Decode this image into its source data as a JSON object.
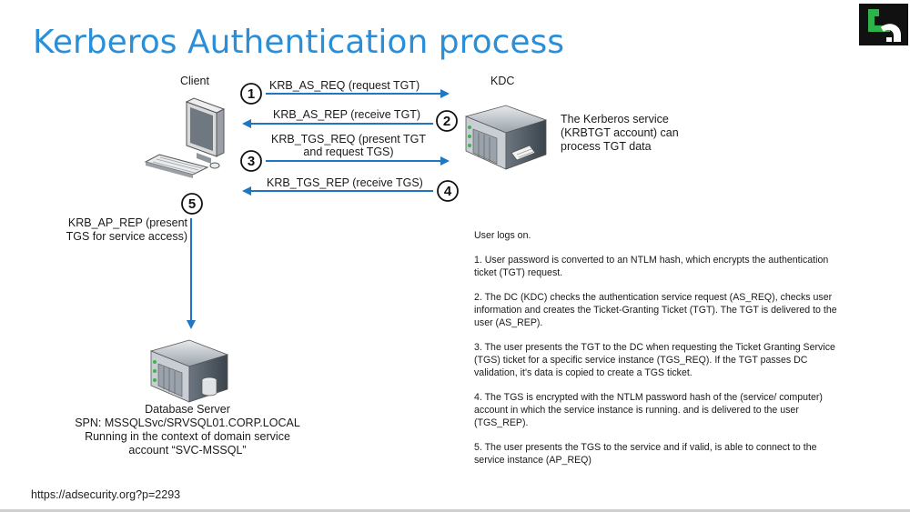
{
  "title": "Kerberos Authentication process",
  "nodes": {
    "client": "Client",
    "kdc": "KDC",
    "kdc_note": [
      "The Kerberos service",
      "(KRBTGT account) can",
      "process TGT data"
    ],
    "db_server": [
      "Database Server",
      "SPN: MSSQLSvc/SRVSQL01.CORP.LOCAL",
      "Running in the context of domain service",
      "account “SVC-MSSQL”"
    ]
  },
  "messages": [
    {
      "step": "1",
      "label": [
        "KRB_AS_REQ (request TGT)"
      ]
    },
    {
      "step": "2",
      "label": [
        "KRB_AS_REP (receive TGT)"
      ]
    },
    {
      "step": "3",
      "label": [
        "KRB_TGS_REQ (present TGT",
        "and request TGS)"
      ]
    },
    {
      "step": "4",
      "label": [
        "KRB_TGS_REP (receive TGS)"
      ]
    },
    {
      "step": "5",
      "label": [
        "KRB_AP_REP (present",
        "TGS for service access)"
      ]
    }
  ],
  "description": {
    "intro": "User logs on.",
    "steps": [
      "1. User password is converted to an NTLM hash, which encrypts the authentication ticket (TGT) request.",
      "2. The DC (KDC) checks the authentication service request (AS_REQ), checks user information and creates the Ticket-Granting Ticket (TGT). The TGT is delivered to the user (AS_REP).",
      "3. The user presents the TGT to the DC when requesting the Ticket Granting Service (TGS) ticket for a specific service instance (TGS_REQ). If the TGT passes DC validation, it's data is copied to create a TGS ticket.",
      "4. The TGS is encrypted with the NTLM password hash of the (service/ computer) account in which the service instance is running. and is delivered to the user (TGS_REP).",
      "5. The user presents the TGS to the service and if valid, is able to connect to the service instance (AP_REQ)"
    ]
  },
  "footer_url": "https://adsecurity.org?p=2293",
  "colors": {
    "title": "#2a8fd8",
    "arrow": "#1f77c4",
    "logo_green": "#2eb34a"
  }
}
